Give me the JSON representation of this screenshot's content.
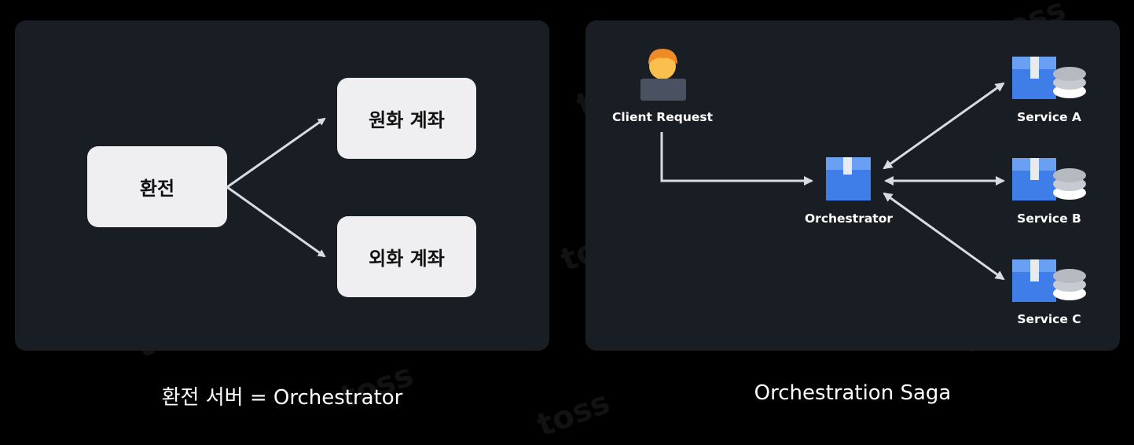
{
  "left_diagram": {
    "source_node": "환전",
    "target_nodes": [
      "원화 계좌",
      "외화 계좌"
    ],
    "caption": "환전 서버 = Orchestrator"
  },
  "right_diagram": {
    "client_label": "Client Request",
    "orchestrator_label": "Orchestrator",
    "services": [
      "Service A",
      "Service B",
      "Service C"
    ],
    "caption": "Orchestration Saga"
  },
  "watermark": "toss",
  "colors": {
    "background": "#000000",
    "panel": "#191d24",
    "box": "#efeff1",
    "arrow": "#d9dbe0",
    "service_blue": "#3f7ee8",
    "service_light_blue": "#6aa0f3",
    "db_gray": "#c7cacf",
    "user_skin": "#fbbf4d",
    "user_hair": "#f08a24",
    "laptop": "#4a5160"
  }
}
